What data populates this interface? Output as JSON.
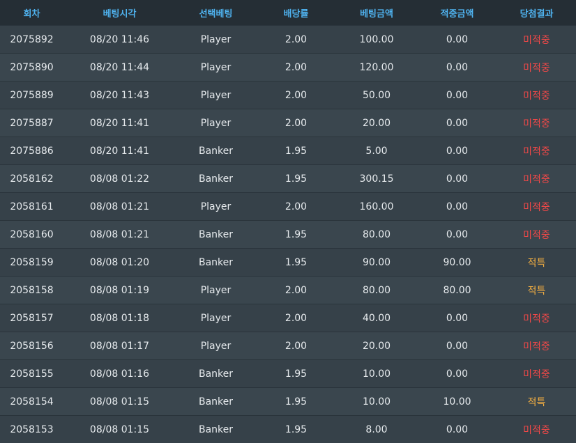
{
  "headers": [
    "회차",
    "베팅시각",
    "선택베팅",
    "배당률",
    "베팅금액",
    "적중금액",
    "당첨결과"
  ],
  "colors": {
    "header_text": "#4fb3f0",
    "miss": "#f04848",
    "hit": "#f5b041"
  },
  "rows": [
    {
      "round": "2075892",
      "time": "08/20 11:46",
      "pick": "Player",
      "odds": "2.00",
      "bet": "100.00",
      "win": "0.00",
      "result": "미적중",
      "status": "miss"
    },
    {
      "round": "2075890",
      "time": "08/20 11:44",
      "pick": "Player",
      "odds": "2.00",
      "bet": "120.00",
      "win": "0.00",
      "result": "미적중",
      "status": "miss"
    },
    {
      "round": "2075889",
      "time": "08/20 11:43",
      "pick": "Player",
      "odds": "2.00",
      "bet": "50.00",
      "win": "0.00",
      "result": "미적중",
      "status": "miss"
    },
    {
      "round": "2075887",
      "time": "08/20 11:41",
      "pick": "Player",
      "odds": "2.00",
      "bet": "20.00",
      "win": "0.00",
      "result": "미적중",
      "status": "miss"
    },
    {
      "round": "2075886",
      "time": "08/20 11:41",
      "pick": "Banker",
      "odds": "1.95",
      "bet": "5.00",
      "win": "0.00",
      "result": "미적중",
      "status": "miss"
    },
    {
      "round": "2058162",
      "time": "08/08 01:22",
      "pick": "Banker",
      "odds": "1.95",
      "bet": "300.15",
      "win": "0.00",
      "result": "미적중",
      "status": "miss"
    },
    {
      "round": "2058161",
      "time": "08/08 01:21",
      "pick": "Player",
      "odds": "2.00",
      "bet": "160.00",
      "win": "0.00",
      "result": "미적중",
      "status": "miss"
    },
    {
      "round": "2058160",
      "time": "08/08 01:21",
      "pick": "Banker",
      "odds": "1.95",
      "bet": "80.00",
      "win": "0.00",
      "result": "미적중",
      "status": "miss"
    },
    {
      "round": "2058159",
      "time": "08/08 01:20",
      "pick": "Banker",
      "odds": "1.95",
      "bet": "90.00",
      "win": "90.00",
      "result": "적특",
      "status": "hit"
    },
    {
      "round": "2058158",
      "time": "08/08 01:19",
      "pick": "Player",
      "odds": "2.00",
      "bet": "80.00",
      "win": "80.00",
      "result": "적특",
      "status": "hit"
    },
    {
      "round": "2058157",
      "time": "08/08 01:18",
      "pick": "Player",
      "odds": "2.00",
      "bet": "40.00",
      "win": "0.00",
      "result": "미적중",
      "status": "miss"
    },
    {
      "round": "2058156",
      "time": "08/08 01:17",
      "pick": "Player",
      "odds": "2.00",
      "bet": "20.00",
      "win": "0.00",
      "result": "미적중",
      "status": "miss"
    },
    {
      "round": "2058155",
      "time": "08/08 01:16",
      "pick": "Banker",
      "odds": "1.95",
      "bet": "10.00",
      "win": "0.00",
      "result": "미적중",
      "status": "miss"
    },
    {
      "round": "2058154",
      "time": "08/08 01:15",
      "pick": "Banker",
      "odds": "1.95",
      "bet": "10.00",
      "win": "10.00",
      "result": "적특",
      "status": "hit"
    },
    {
      "round": "2058153",
      "time": "08/08 01:15",
      "pick": "Banker",
      "odds": "1.95",
      "bet": "8.00",
      "win": "0.00",
      "result": "미적중",
      "status": "miss"
    }
  ]
}
